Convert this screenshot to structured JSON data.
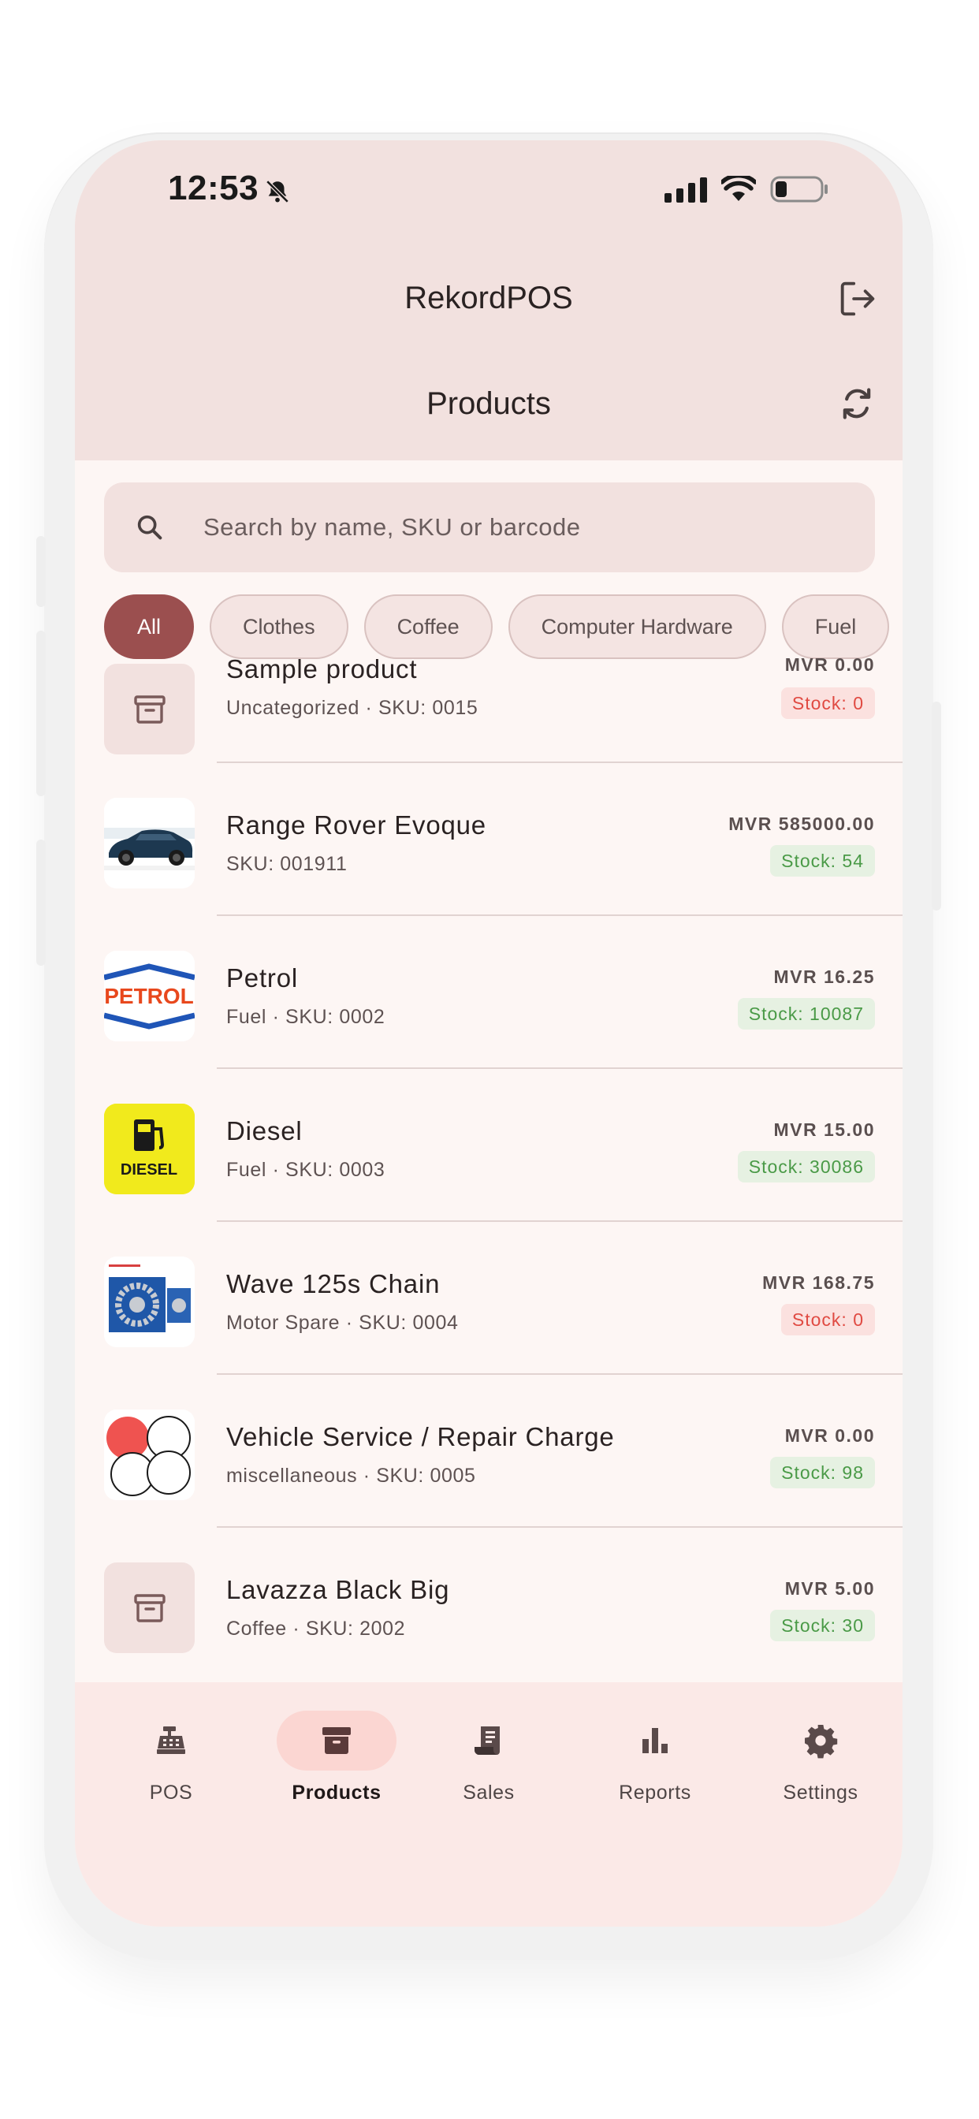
{
  "status_bar": {
    "time": "12:53"
  },
  "app": {
    "title": "RekordPOS",
    "page_title": "Products"
  },
  "search": {
    "placeholder": "Search by name, SKU or barcode"
  },
  "categories": [
    "All",
    "Clothes",
    "Coffee",
    "Computer Hardware",
    "Fuel"
  ],
  "products": [
    {
      "name": "Sample product",
      "subtitle": "Uncategorized · SKU: 0015",
      "price": "MVR  0.00",
      "stock": "Stock: 0",
      "stock_status": "out",
      "image": "placeholder-box-icon"
    },
    {
      "name": "Range Rover Evoque",
      "subtitle": "SKU: 001911",
      "price": "MVR  585000.00",
      "stock": "Stock: 54",
      "stock_status": "ok",
      "image": "car-image"
    },
    {
      "name": "Petrol",
      "subtitle": "Fuel · SKU: 0002",
      "price": "MVR  16.25",
      "stock": "Stock: 10087",
      "stock_status": "ok",
      "image": "petrol-logo"
    },
    {
      "name": "Diesel",
      "subtitle": "Fuel · SKU: 0003",
      "price": "MVR  15.00",
      "stock": "Stock: 30086",
      "stock_status": "ok",
      "image": "diesel-logo"
    },
    {
      "name": "Wave 125s Chain",
      "subtitle": "Motor Spare · SKU: 0004",
      "price": "MVR  168.75",
      "stock": "Stock: 0",
      "stock_status": "out",
      "image": "chain-image"
    },
    {
      "name": "Vehicle Service / Repair Charge",
      "subtitle": "miscellaneous · SKU: 0005",
      "price": "MVR  0.00",
      "stock": "Stock: 98",
      "stock_status": "ok",
      "image": "circles-image"
    },
    {
      "name": "Lavazza Black Big",
      "subtitle": "Coffee · SKU: 2002",
      "price": "MVR  5.00",
      "stock": "Stock: 30",
      "stock_status": "ok",
      "image": "placeholder-box-icon"
    }
  ],
  "petrol_logo_text": "PETROL",
  "diesel_logo_text": "DIESEL",
  "nav": {
    "items": [
      {
        "label": "POS",
        "icon": "cash-register-icon"
      },
      {
        "label": "Products",
        "icon": "archive-box-icon",
        "active": true
      },
      {
        "label": "Sales",
        "icon": "receipt-icon"
      },
      {
        "label": "Reports",
        "icon": "bar-chart-icon"
      },
      {
        "label": "Settings",
        "icon": "gear-icon"
      }
    ]
  },
  "colors": {
    "accent": "#9b4f4f",
    "header_bg": "#f2e1df",
    "stock_ok": "#4a9a47",
    "stock_out": "#e04a42"
  }
}
